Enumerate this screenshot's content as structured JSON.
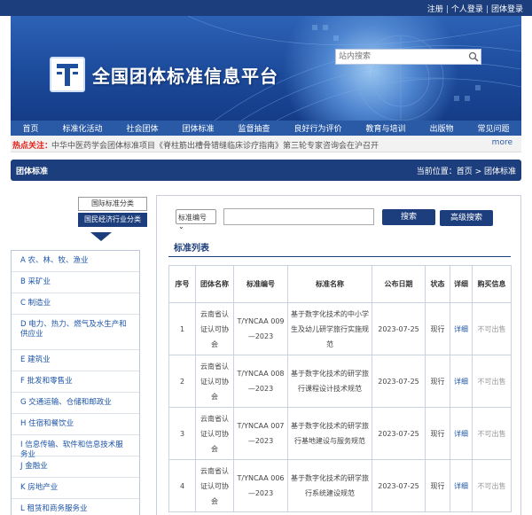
{
  "top": {
    "links": [
      "注册",
      "个人登录",
      "团体登录"
    ]
  },
  "header": {
    "site_title": "全国团体标准信息平台",
    "search_placeholder": "站内搜索"
  },
  "nav": {
    "items": [
      "首页",
      "标准化活动",
      "社会团体",
      "团体标准",
      "监督抽查",
      "良好行为评价",
      "教育与培训",
      "出版物",
      "常见问题"
    ]
  },
  "hot": {
    "label": "热点关注：",
    "text": "中华中医药学会团体标准项目《脊柱筋出槽骨错缝临床诊疗指南》第三轮专家咨询会在沪召开",
    "more": "more"
  },
  "section": {
    "title": "团体标准",
    "breadcrumb_prefix": "当前位置：",
    "breadcrumb": [
      "首页",
      "团体标准"
    ],
    "breadcrumb_sep": " > "
  },
  "category_tabs": [
    "国际标准分类",
    "国民经济行业分类"
  ],
  "categories": [
    "A 农、林、牧、渔业",
    "B 采矿业",
    "C 制造业",
    "D 电力、热力、燃气及水生产和供应业",
    "E 建筑业",
    "F 批发和零售业",
    "G 交通运输、仓储和邮政业",
    "H 住宿和餐饮业",
    "I 信息传输、软件和信息技术服务业",
    "J 金融业",
    "K 房地产业",
    "L 租赁和商务服务业"
  ],
  "search": {
    "select_value": "标准编号",
    "search_button": "搜索",
    "advanced_button": "高级搜索"
  },
  "list": {
    "title": "标准列表",
    "headers": [
      "序号",
      "团体名称",
      "标准编号",
      "标准名称",
      "公布日期",
      "状态",
      "详细",
      "购买信息"
    ],
    "rows": [
      [
        "1",
        "云南省认证认可协会",
        "T/YNCAA 009—2023",
        "基于数字化技术的中小学生及幼儿研学旅行实施规范",
        "2023-07-25",
        "现行",
        "详细",
        "不可出售"
      ],
      [
        "2",
        "云南省认证认可协会",
        "T/YNCAA 008—2023",
        "基于数字化技术的研学旅行课程设计技术规范",
        "2023-07-25",
        "现行",
        "详细",
        "不可出售"
      ],
      [
        "3",
        "云南省认证认可协会",
        "T/YNCAA 007—2023",
        "基于数字化技术的研学旅行基地建设与服务规范",
        "2023-07-25",
        "现行",
        "详细",
        "不可出售"
      ],
      [
        "4",
        "云南省认证认可协会",
        "T/YNCAA 006—2023",
        "基于数字化技术的研学旅行系统建设规范",
        "2023-07-25",
        "现行",
        "详细",
        "不可出售"
      ]
    ]
  }
}
